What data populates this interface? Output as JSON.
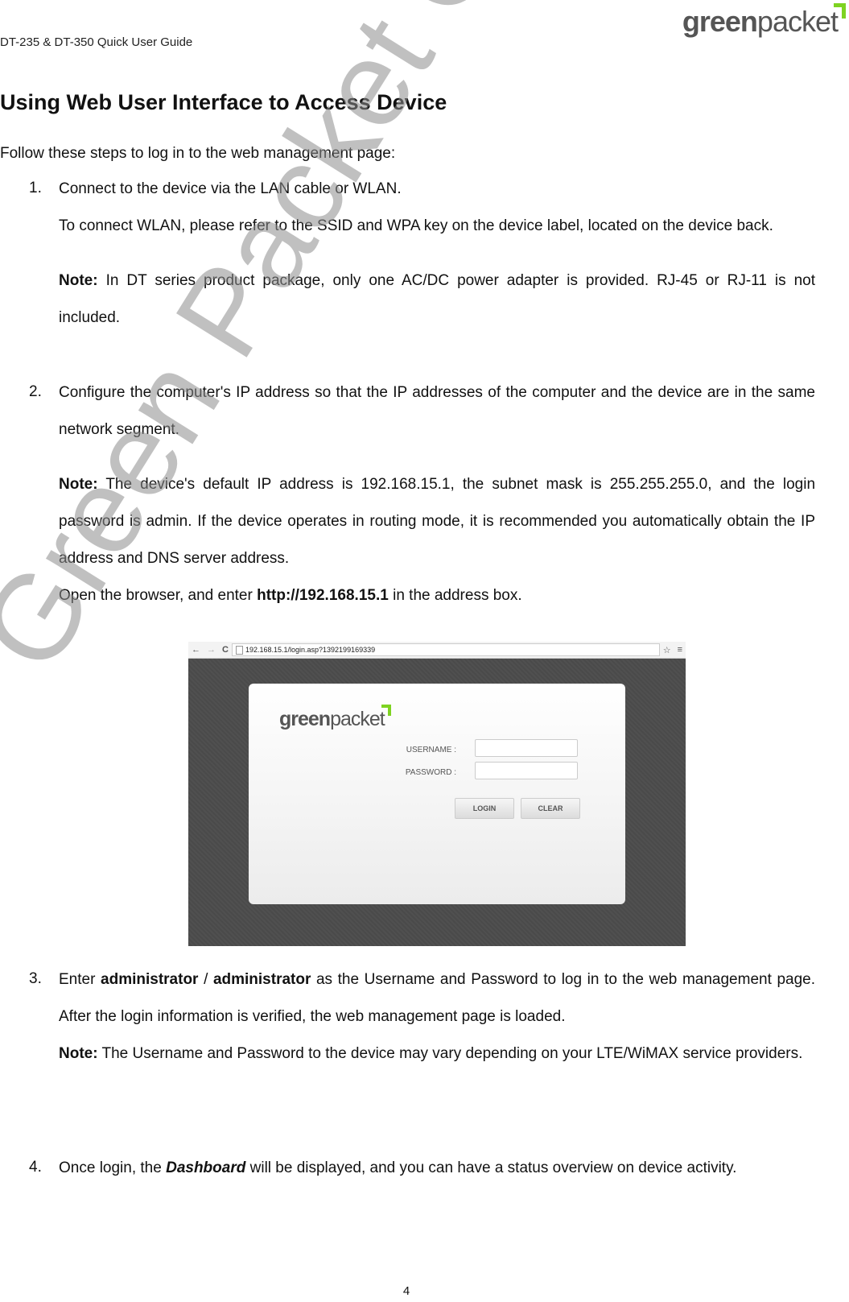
{
  "header": {
    "doc_title": "DT-235 & DT-350 Quick User Guide",
    "logo_bold": "green",
    "logo_light": "packet",
    "brand_color": "#7ed321"
  },
  "section_title": "Using Web User Interface to Access Device",
  "intro": "Follow these steps to log in to the web management page:",
  "steps": [
    {
      "number": "1.",
      "lines": [
        "Connect to the device via the LAN cable or WLAN.",
        "To connect WLAN, please refer to the SSID and WPA key on the device label, located on the device back."
      ],
      "note_label": "Note:",
      "note": "In DT series product package, only one AC/DC power adapter is provided. RJ-45 or RJ-11 is not included."
    },
    {
      "number": "2.",
      "text": "Configure the computer's IP address so that the IP addresses of the computer and the device are in the same network segment.",
      "note_label": "Note:",
      "note": "The device's default IP address is 192.168.15.1, the subnet mask is 255.255.255.0, and the login password is admin. If the device operates in routing mode, it is recommended you automatically obtain the IP address and DNS server address.",
      "open_pre": "Open the browser, and enter",
      "open_url": "http://192.168.15.1",
      "open_post": "in the address box."
    },
    {
      "number": "3.",
      "pre": "Enter",
      "user": "administrator",
      "sep": "/",
      "pass": "administrator",
      "post": "as the Username and Password to log in to the web management page. After the login information is verified, the web management page is loaded.",
      "note_label": "Note:",
      "note": "The Username and Password to the device may vary depending on your LTE/WiMAX service providers."
    },
    {
      "number": "4.",
      "pre": "Once login, the",
      "emph": "Dashboard",
      "post": "will be displayed, and you can have a status overview on device activity."
    }
  ],
  "screenshot": {
    "back": "←",
    "forward": "→",
    "reload": "C",
    "url": "192.168.15.1/login.asp?1392199169339",
    "star": "☆",
    "menu": "≡",
    "logo_bold": "green",
    "logo_light": "packet",
    "username_label": "USERNAME :",
    "password_label": "PASSWORD :",
    "login_button": "LOGIN",
    "clear_button": "CLEAR"
  },
  "watermark": "Green Packet Confidential",
  "page_number": "4"
}
